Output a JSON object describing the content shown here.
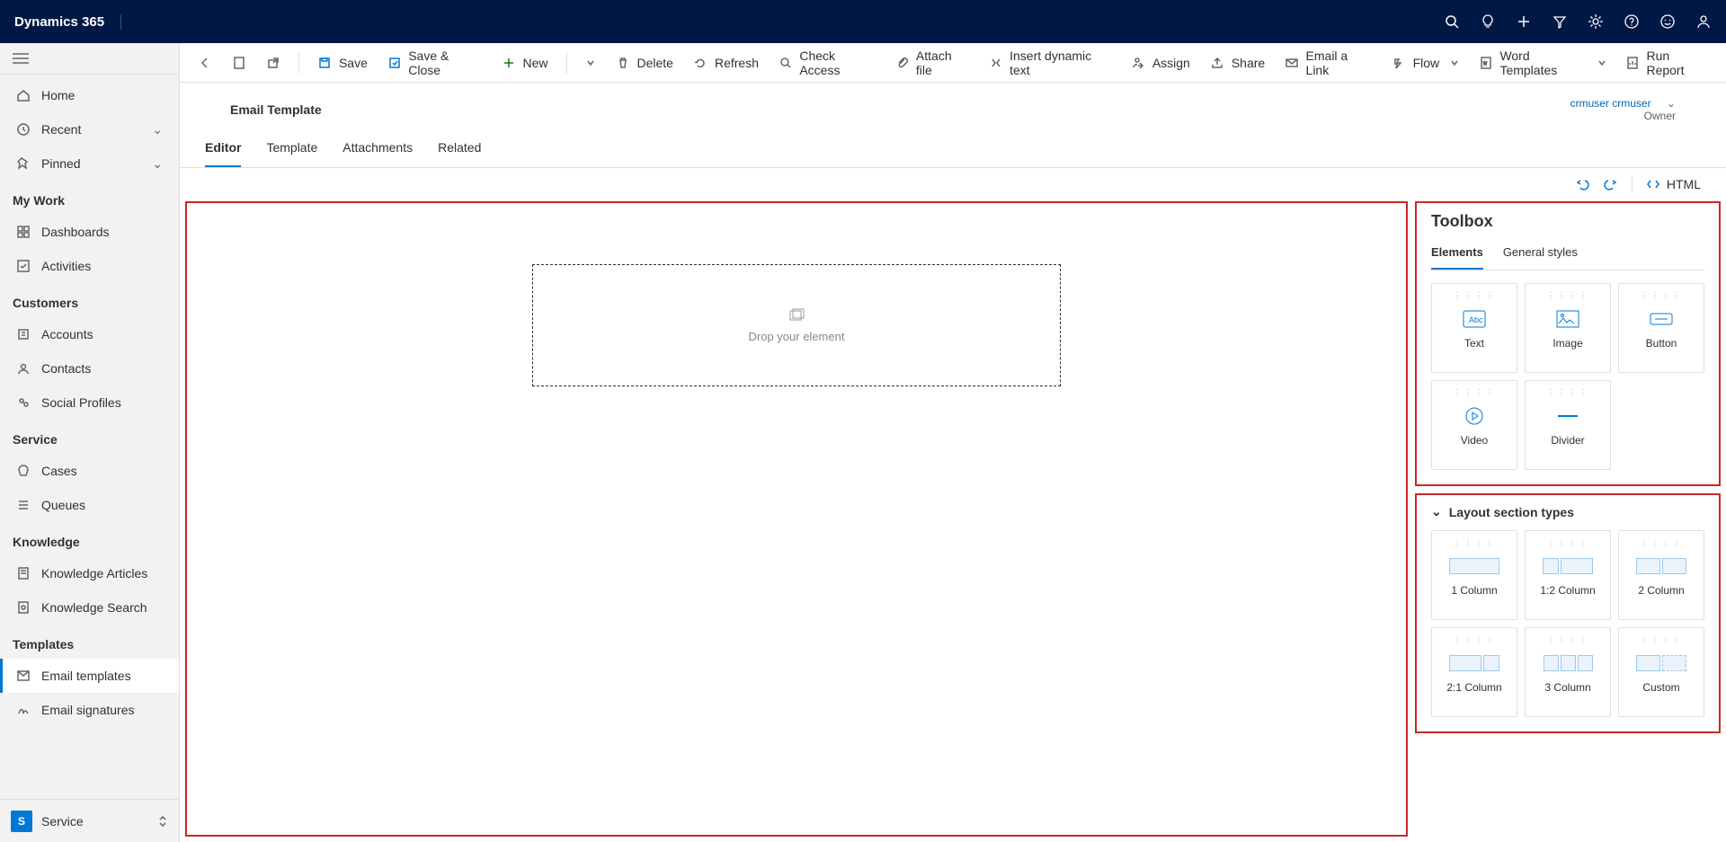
{
  "app": {
    "title": "Dynamics 365"
  },
  "sidebar": {
    "home": "Home",
    "recent": "Recent",
    "pinned": "Pinned",
    "myWork": "My Work",
    "dashboards": "Dashboards",
    "activities": "Activities",
    "customers": "Customers",
    "accounts": "Accounts",
    "contacts": "Contacts",
    "socialProfiles": "Social Profiles",
    "service": "Service",
    "cases": "Cases",
    "queues": "Queues",
    "knowledge": "Knowledge",
    "knowledgeArticles": "Knowledge Articles",
    "knowledgeSearch": "Knowledge Search",
    "templates": "Templates",
    "emailTemplates": "Email templates",
    "emailSignatures": "Email signatures",
    "areaLetter": "S",
    "areaLabel": "Service"
  },
  "commandbar": {
    "save": "Save",
    "saveClose": "Save & Close",
    "new": "New",
    "delete": "Delete",
    "refresh": "Refresh",
    "checkAccess": "Check Access",
    "attachFile": "Attach file",
    "insertDynamic": "Insert dynamic text",
    "assign": "Assign",
    "share": "Share",
    "emailLink": "Email a Link",
    "flow": "Flow",
    "wordTemplates": "Word Templates",
    "runReport": "Run Report"
  },
  "record": {
    "formTitle": "Email Template",
    "ownerName": "crmuser crmuser",
    "ownerLabel": "Owner"
  },
  "tabs": {
    "editor": "Editor",
    "template": "Template",
    "attachments": "Attachments",
    "related": "Related"
  },
  "editorToolbar": {
    "html": "HTML"
  },
  "canvas": {
    "dropText": "Drop your element"
  },
  "toolbox": {
    "title": "Toolbox",
    "tabElements": "Elements",
    "tabGeneral": "General styles",
    "text": "Text",
    "image": "Image",
    "button": "Button",
    "video": "Video",
    "divider": "Divider"
  },
  "layouts": {
    "title": "Layout section types",
    "c1": "1 Column",
    "c12": "1:2 Column",
    "c2": "2 Column",
    "c21": "2:1 Column",
    "c3": "3 Column",
    "custom": "Custom"
  }
}
